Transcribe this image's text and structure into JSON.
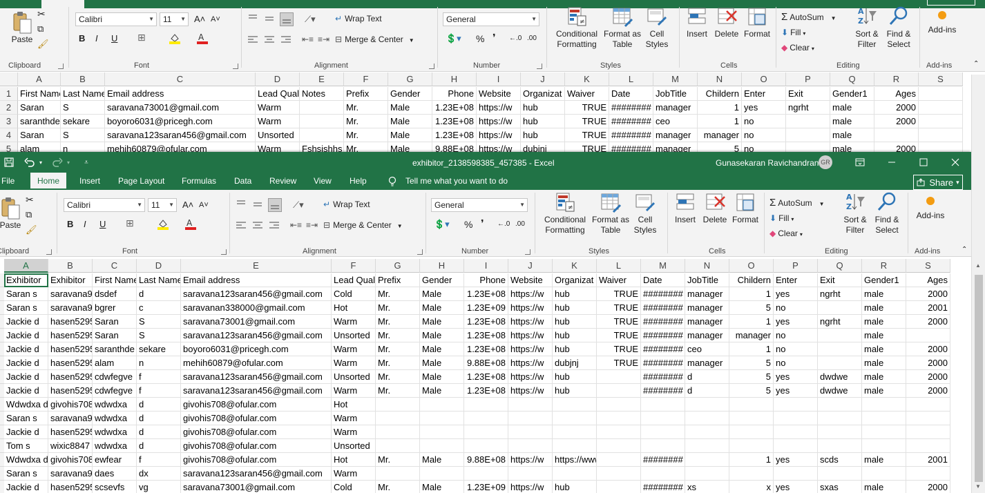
{
  "back_window": {
    "ribbon": {
      "font_name": "Calibri",
      "font_size": "11",
      "wrap_text": "Wrap Text",
      "merge_center": "Merge & Center",
      "number_format": "General",
      "paste": "Paste",
      "conditional": "Conditional",
      "conditional2": "Formatting",
      "format_as": "Format as",
      "format_as2": "Table",
      "cell": "Cell",
      "styles": "Styles",
      "insert": "Insert",
      "delete": "Delete",
      "format": "Format",
      "autosum": "AutoSum",
      "fill": "Fill",
      "clear": "Clear",
      "sort": "Sort &",
      "sort2": "Filter",
      "find": "Find &",
      "find2": "Select",
      "addins": "Add-ins",
      "groups": [
        "Clipboard",
        "Font",
        "Alignment",
        "Number",
        "Styles",
        "Cells",
        "Editing",
        "Add-ins"
      ]
    },
    "col_letters": [
      "A",
      "B",
      "C",
      "D",
      "E",
      "F",
      "G",
      "H",
      "I",
      "J",
      "K",
      "L",
      "M",
      "N",
      "O",
      "P",
      "Q",
      "R",
      "S"
    ],
    "row_numbers": [
      "1",
      "2",
      "3",
      "4",
      "5"
    ],
    "rows": [
      [
        "First Name",
        "Last Name",
        "Email address",
        "Lead Qual",
        "Notes",
        "Prefix",
        "Gender",
        "Phone",
        "Website",
        "Organizat",
        "Waiver",
        "Date",
        "JobTitle",
        "Childern",
        "Enter",
        "Exit",
        "Gender1",
        "Ages",
        ""
      ],
      [
        "Saran",
        "S",
        "saravana73001@gmail.com",
        "Warm",
        "",
        "Mr.",
        "Male",
        "1.23E+08",
        "https://w",
        "hub",
        "TRUE",
        "########",
        "manager",
        "1",
        "yes",
        "ngrht",
        "male",
        "2000",
        ""
      ],
      [
        "saranthde",
        "sekare",
        "boyoro6031@pricegh.com",
        "Warm",
        "",
        "Mr.",
        "Male",
        "1.23E+08",
        "https://w",
        "hub",
        "TRUE",
        "########",
        "ceo",
        "1",
        "no",
        "",
        "male",
        "2000",
        ""
      ],
      [
        "Saran",
        "S",
        "saravana123saran456@gmail.com",
        "Unsorted",
        "",
        "Mr.",
        "Male",
        "1.23E+08",
        "https://w",
        "hub",
        "TRUE",
        "########",
        "manager",
        "manager",
        "no",
        "",
        "male",
        "",
        ""
      ],
      [
        "alam",
        "n",
        "mehih60879@ofular.com",
        "Warm",
        "Fshsishhs",
        "Mr.",
        "Male",
        "9.88E+08",
        "https://w",
        "dubjnj",
        "TRUE",
        "########",
        "manager",
        "5",
        "no",
        "",
        "male",
        "2000",
        ""
      ]
    ]
  },
  "front_window": {
    "title": "exhibitor_2138598385_457385  -  Excel",
    "user_name": "Gunasekaran Ravichandran",
    "user_initials": "GR",
    "tabs": [
      "File",
      "Home",
      "Insert",
      "Page Layout",
      "Formulas",
      "Data",
      "Review",
      "View",
      "Help"
    ],
    "tell_me": "Tell me what you want to do",
    "share": "Share",
    "ribbon": {
      "paste": "Paste",
      "font_name": "Calibri",
      "font_size": "11",
      "wrap_text": "Wrap Text",
      "merge_center": "Merge & Center",
      "number_format": "General",
      "conditional": "Conditional",
      "conditional2": "Formatting",
      "format_as": "Format as",
      "format_as2": "Table",
      "cell": "Cell",
      "styles": "Styles",
      "insert": "Insert",
      "delete": "Delete",
      "format": "Format",
      "autosum": "AutoSum",
      "fill": "Fill",
      "clear": "Clear",
      "sort": "Sort &",
      "sort2": "Filter",
      "find": "Find &",
      "find2": "Select",
      "addins": "Add-ins",
      "groups": [
        "Clipboard",
        "Font",
        "Alignment",
        "Number",
        "Styles",
        "Cells",
        "Editing",
        "Add-ins"
      ]
    },
    "col_letters": [
      "A",
      "B",
      "C",
      "D",
      "E",
      "F",
      "G",
      "H",
      "I",
      "J",
      "K",
      "L",
      "M",
      "N",
      "O",
      "P",
      "Q",
      "R",
      "S"
    ],
    "rows": [
      [
        "Exhibitor",
        "Exhibitor",
        "First Name",
        "Last Name",
        "Email address",
        "Lead Qual",
        "Prefix",
        "Gender",
        "Phone",
        "Website",
        "Organizat",
        "Waiver",
        "Date",
        "JobTitle",
        "Childern",
        "Enter",
        "Exit",
        "Gender1",
        "Ages"
      ],
      [
        "Saran s",
        "saravana9",
        "dsdef",
        "d",
        "saravana123saran456@gmail.com",
        "Cold",
        "Mr.",
        "Male",
        "1.23E+08",
        "https://w",
        "hub",
        "TRUE",
        "########",
        "manager",
        "1",
        "yes",
        "ngrht",
        "male",
        "2000"
      ],
      [
        "Saran s",
        "saravana9",
        "bgrer",
        "c",
        "saravanan338000@gmail.com",
        "Hot",
        "Mr.",
        "Male",
        "1.23E+09",
        "https://w",
        "hub",
        "TRUE",
        "########",
        "manager",
        "5",
        "no",
        "",
        "male",
        "2001"
      ],
      [
        "Jackie d",
        "hasen5295",
        "Saran",
        "S",
        "saravana73001@gmail.com",
        "Warm",
        "Mr.",
        "Male",
        "1.23E+08",
        "https://w",
        "hub",
        "TRUE",
        "########",
        "manager",
        "1",
        "yes",
        "ngrht",
        "male",
        "2000"
      ],
      [
        "Jackie d",
        "hasen5295",
        "Saran",
        "S",
        "saravana123saran456@gmail.com",
        "Unsorted",
        "Mr.",
        "Male",
        "1.23E+08",
        "https://w",
        "hub",
        "TRUE",
        "########",
        "manager",
        "manager",
        "no",
        "",
        "male",
        ""
      ],
      [
        "Jackie d",
        "hasen5295",
        "saranthde",
        "sekare",
        "boyoro6031@pricegh.com",
        "Warm",
        "Mr.",
        "Male",
        "1.23E+08",
        "https://w",
        "hub",
        "TRUE",
        "########",
        "ceo",
        "1",
        "no",
        "",
        "male",
        "2000"
      ],
      [
        "Jackie d",
        "hasen5295",
        "alam",
        "n",
        "mehih60879@ofular.com",
        "Warm",
        "Mr.",
        "Male",
        "9.88E+08",
        "https://w",
        "dubjnj",
        "TRUE",
        "########",
        "manager",
        "5",
        "no",
        "",
        "male",
        "2000"
      ],
      [
        "Jackie d",
        "hasen5295",
        "cdwfegve",
        "f",
        "saravana123saran456@gmail.com",
        "Unsorted",
        "Mr.",
        "Male",
        "1.23E+08",
        "https://w",
        "hub",
        "",
        "########",
        "d",
        "5",
        "yes",
        "dwdwe",
        "male",
        "2000"
      ],
      [
        "Jackie d",
        "hasen5295",
        "cdwfegve",
        "f",
        "saravana123saran456@gmail.com",
        "Warm",
        "Mr.",
        "Male",
        "1.23E+08",
        "https://w",
        "hub",
        "",
        "########",
        "d",
        "5",
        "yes",
        "dwdwe",
        "male",
        "2000"
      ],
      [
        "Wdwdxa d",
        "givohis708",
        "wdwdxa",
        "d",
        "givohis708@ofular.com",
        "Hot",
        "",
        "",
        "",
        "",
        "",
        "",
        "",
        "",
        "",
        "",
        "",
        "",
        ""
      ],
      [
        "Saran s",
        "saravana9",
        "wdwdxa",
        "d",
        "givohis708@ofular.com",
        "Warm",
        "",
        "",
        "",
        "",
        "",
        "",
        "",
        "",
        "",
        "",
        "",
        "",
        ""
      ],
      [
        "Jackie d",
        "hasen5295",
        "wdwdxa",
        "d",
        "givohis708@ofular.com",
        "Warm",
        "",
        "",
        "",
        "",
        "",
        "",
        "",
        "",
        "",
        "",
        "",
        "",
        ""
      ],
      [
        "Tom s",
        "wixic8847",
        "wdwdxa",
        "d",
        "givohis708@ofular.com",
        "Unsorted",
        "",
        "",
        "",
        "",
        "",
        "",
        "",
        "",
        "",
        "",
        "",
        "",
        ""
      ],
      [
        "Wdwdxa d",
        "givohis708",
        "ewfear",
        "f",
        "givohis708@ofular.com",
        "Hot",
        "Mr.",
        "Male",
        "9.88E+08",
        "https://w",
        "https://www.inta.vc",
        "",
        "########",
        "",
        "1",
        "yes",
        "scds",
        "male",
        "2001"
      ],
      [
        "Saran s",
        "saravana9",
        "daes",
        "dx",
        "saravana123saran456@gmail.com",
        "Warm",
        "",
        "",
        "",
        "",
        "",
        "",
        "",
        "",
        "",
        "",
        "",
        "",
        ""
      ],
      [
        "Jackie d",
        "hasen5295",
        "scsevfs",
        "vg",
        "saravana73001@gmail.com",
        "Cold",
        "Mr.",
        "Male",
        "1.23E+09",
        "https://w",
        "hub",
        "",
        "########",
        "xs",
        "x",
        "yes",
        "sxas",
        "male",
        "2000"
      ]
    ]
  }
}
